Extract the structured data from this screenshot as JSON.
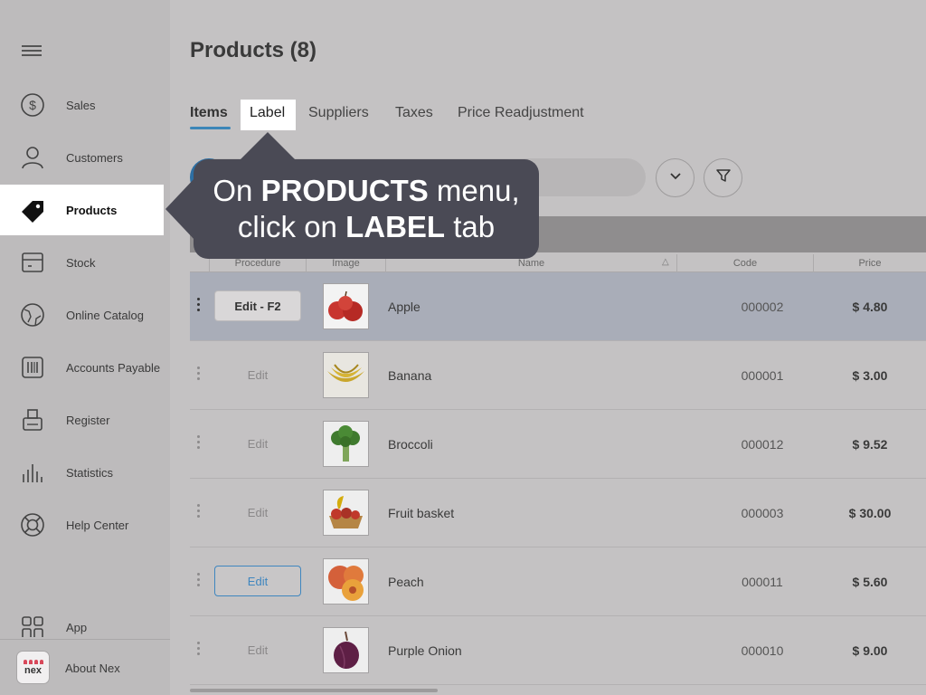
{
  "sidebar": {
    "items": [
      {
        "label": "Sales",
        "icon": "dollar-circle-icon"
      },
      {
        "label": "Customers",
        "icon": "user-icon"
      },
      {
        "label": "Products",
        "icon": "tag-icon"
      },
      {
        "label": "Stock",
        "icon": "box-icon"
      },
      {
        "label": "Online Catalog",
        "icon": "globe-icon"
      },
      {
        "label": "Accounts Payable",
        "icon": "barcode-icon"
      },
      {
        "label": "Register",
        "icon": "register-icon"
      },
      {
        "label": "Statistics",
        "icon": "bar-chart-icon"
      },
      {
        "label": "Help Center",
        "icon": "lifebuoy-icon"
      }
    ],
    "app_label": "App",
    "about_label": "About Nex",
    "logo_text": "nex"
  },
  "header": {
    "title": "Products (8)"
  },
  "tabs": [
    "Items",
    "Label",
    "Suppliers",
    "Taxes",
    "Price Readjustment"
  ],
  "table": {
    "columns": [
      "Procedure",
      "Image",
      "Name",
      "Code",
      "Price"
    ],
    "rows": [
      {
        "edit": "Edit - F2",
        "name": "Apple",
        "code": "000002",
        "price": "$ 4.80"
      },
      {
        "edit": "Edit",
        "name": "Banana",
        "code": "000001",
        "price": "$ 3.00"
      },
      {
        "edit": "Edit",
        "name": "Broccoli",
        "code": "000012",
        "price": "$ 9.52"
      },
      {
        "edit": "Edit",
        "name": "Fruit basket",
        "code": "000003",
        "price": "$ 30.00"
      },
      {
        "edit": "Edit",
        "name": "Peach",
        "code": "000011",
        "price": "$ 5.60"
      },
      {
        "edit": "Edit",
        "name": "Purple Onion",
        "code": "000010",
        "price": "$ 9.00"
      }
    ]
  },
  "callout": {
    "pre1": "On ",
    "bold1": "PRODUCTS",
    "post1": " menu,",
    "pre2": "click on ",
    "bold2": "LABEL",
    "post2": " tab"
  },
  "colors": {
    "accent": "#3c86b8",
    "callout_bg": "#4a4a55",
    "logo_red": "#d8485a"
  }
}
